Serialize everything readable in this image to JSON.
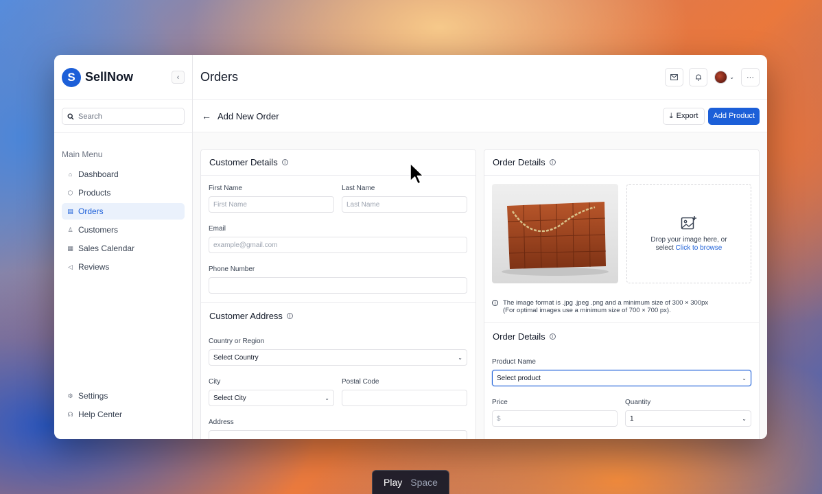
{
  "app": {
    "brand_letter": "S",
    "brand_name": "SellNow"
  },
  "sidebar": {
    "search_placeholder": "Search",
    "menu_title": "Main Menu",
    "items": [
      {
        "label": "Dashboard",
        "icon": "home-icon",
        "active": false
      },
      {
        "label": "Products",
        "icon": "box-icon",
        "active": false
      },
      {
        "label": "Orders",
        "icon": "clipboard-icon",
        "active": true
      },
      {
        "label": "Customers",
        "icon": "user-icon",
        "active": false
      },
      {
        "label": "Sales Calendar",
        "icon": "calendar-icon",
        "active": false
      },
      {
        "label": "Reviews",
        "icon": "megaphone-icon",
        "active": false
      }
    ],
    "bottom_items": [
      {
        "label": "Settings",
        "icon": "gear-icon"
      },
      {
        "label": "Help Center",
        "icon": "headphones-icon"
      }
    ]
  },
  "header": {
    "title": "Orders"
  },
  "subheader": {
    "title": "Add New Order",
    "export_label": "Export",
    "add_product_label": "Add Product"
  },
  "customer_details": {
    "title": "Customer Details",
    "first_name_label": "First Name",
    "first_name_placeholder": "First Name",
    "last_name_label": "Last Name",
    "last_name_placeholder": "Last Name",
    "email_label": "Email",
    "email_placeholder": "example@gmail.com",
    "phone_label": "Phone Number",
    "phone_value": ""
  },
  "customer_address": {
    "title": "Customer Address",
    "country_label": "Country or Region",
    "country_value": "Select Country",
    "city_label": "City",
    "city_value": "Select City",
    "postal_label": "Postal Code",
    "postal_value": "",
    "address_label": "Address"
  },
  "order_image": {
    "title": "Order Details",
    "drop_text": "Drop your image here, or",
    "select_text": "select",
    "browse_link": "Click to browse",
    "note_line1": "The image format is .jpg .jpeg .png and a minimum size of 300 × 300px",
    "note_line2": "(For optimal images use a minimum size of 700 × 700 px)."
  },
  "order_details": {
    "title": "Order Details",
    "product_label": "Product Name",
    "product_value": "Select product",
    "price_label": "Price",
    "price_placeholder": "$",
    "quantity_label": "Quantity",
    "quantity_value": "1"
  },
  "hint": {
    "action": "Play",
    "key": "Space"
  },
  "colors": {
    "accent": "#1c5fd8",
    "active_bg": "#eaf1fc"
  }
}
